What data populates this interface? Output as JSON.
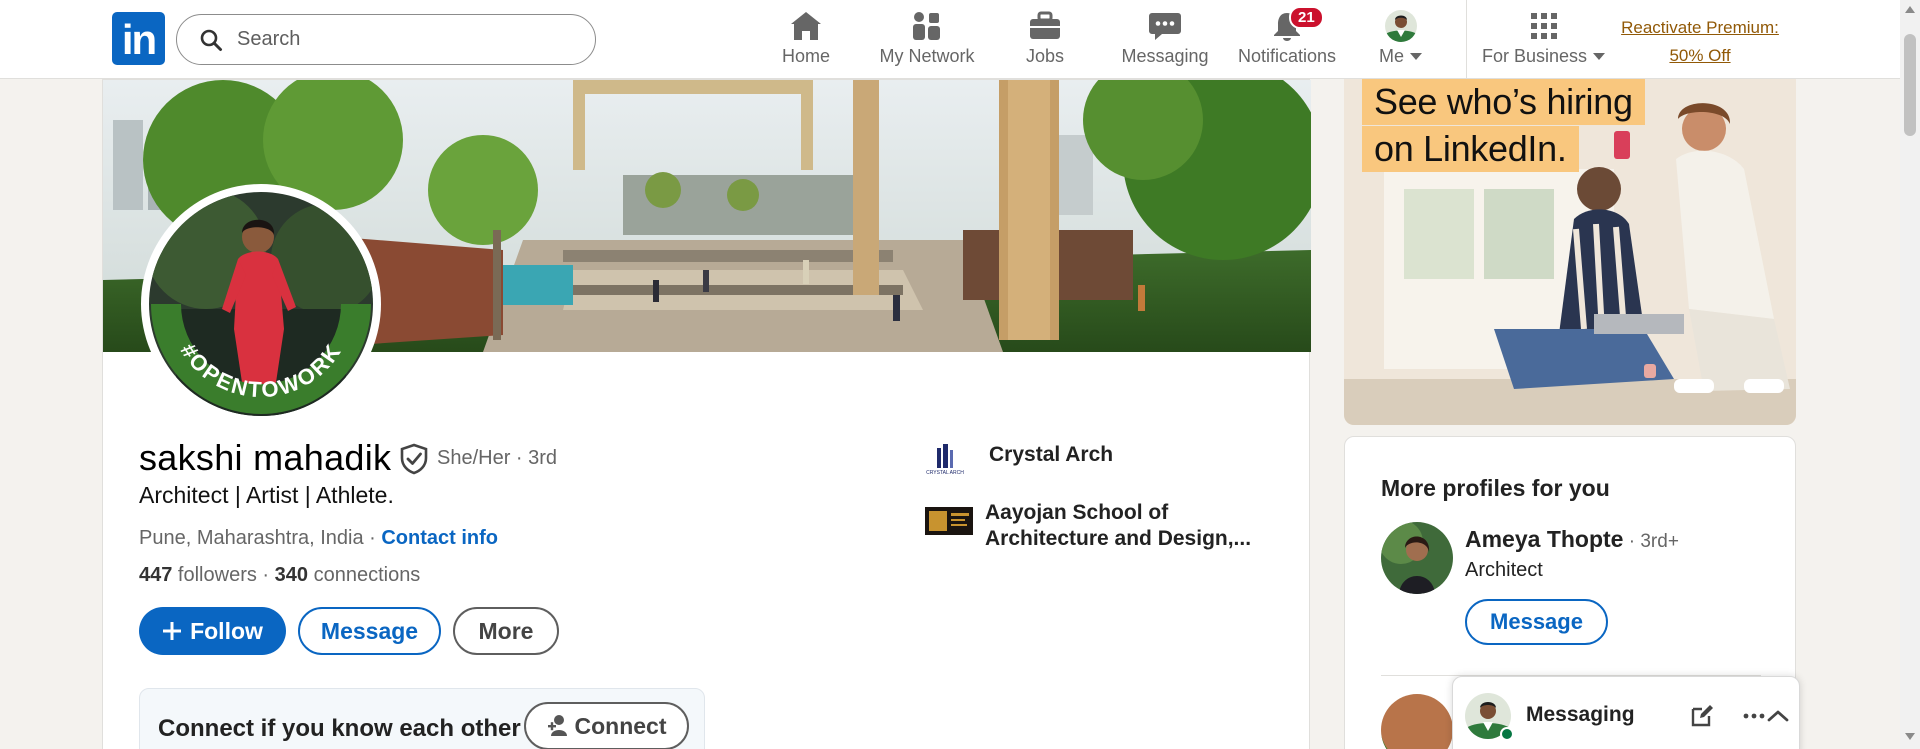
{
  "nav": {
    "logo_text": "in",
    "search_placeholder": "Search",
    "items": [
      {
        "label": "Home",
        "icon": "home-icon"
      },
      {
        "label": "My Network",
        "icon": "my-network-icon"
      },
      {
        "label": "Jobs",
        "icon": "briefcase-icon"
      },
      {
        "label": "Messaging",
        "icon": "chat-bubble-icon"
      },
      {
        "label": "Notifications",
        "icon": "bell-icon",
        "badge": "21"
      },
      {
        "label": "Me",
        "icon": "avatar"
      },
      {
        "label": "For Business",
        "icon": "grid-icon"
      }
    ],
    "premium_line1": "Reactivate Premium:",
    "premium_line2": "50% Off"
  },
  "profile": {
    "name": "sakshi mahadik",
    "pronouns": "She/Her · 3rd",
    "headline": "Architect | Artist | Athlete.",
    "location": "Pune, Maharashtra, India · ",
    "contact_label": "Contact info",
    "followers_count": "447",
    "followers_label": " followers",
    "connections_sep": "  · ",
    "connections_count": "340",
    "connections_label": " connections",
    "frame_text": "#OPENTOWORK",
    "buttons": {
      "follow": "Follow",
      "message": "Message",
      "more": "More"
    },
    "orgs": [
      {
        "name": "Crystal Arch",
        "logo_text": "CRYSTAL ARCH"
      },
      {
        "name_line1": "Aayojan School of",
        "name_line2": "Architecture and Design,..."
      }
    ],
    "connect_prompt": "Connect if you know each other",
    "connect_button": "Connect"
  },
  "ad": {
    "line1": "See who’s hiring",
    "line2": "on LinkedIn."
  },
  "more_profiles": {
    "title": "More profiles for you",
    "people": [
      {
        "name": "Ameya Thopte",
        "degree": " · 3rd+",
        "title": "Architect",
        "button": "Message"
      }
    ]
  },
  "messaging": {
    "title": "Messaging"
  },
  "colors": {
    "brand": "#0a66c2",
    "badge": "#cb112d",
    "premium": "#915907",
    "open_to_work": "#3a7d2c",
    "ad_highlight": "#f9c77e"
  }
}
